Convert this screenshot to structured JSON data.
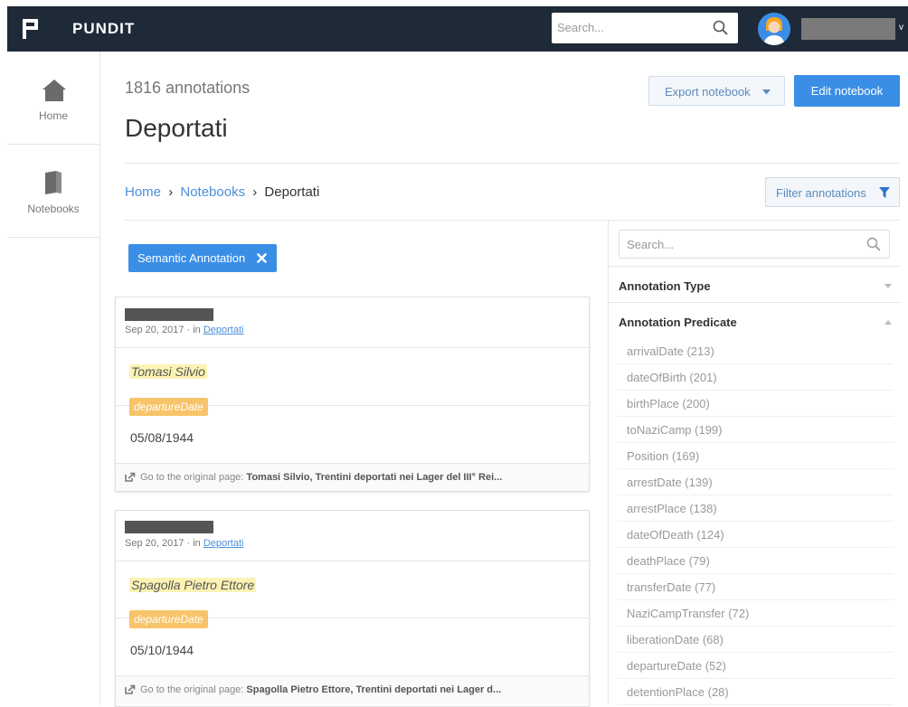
{
  "app": {
    "brand": "PUNDIT"
  },
  "header": {
    "search_placeholder": "Search...",
    "user_menu_caret": "v"
  },
  "nav": [
    {
      "label": "Home",
      "icon": "home-icon"
    },
    {
      "label": "Notebooks",
      "icon": "notebook-icon"
    }
  ],
  "main": {
    "count": "1816 annotations",
    "title": "Deportati",
    "export_label": "Export notebook",
    "edit_label": "Edit notebook",
    "breadcrumb": {
      "home": "Home",
      "sep1": "›",
      "notebooks": "Notebooks",
      "sep2": "›",
      "current": "Deportati"
    },
    "filter_label": "Filter annotations",
    "active_filter": "Semantic Annotation"
  },
  "cards": [
    {
      "date": "Sep 20, 2017 · in ",
      "notebook": "Deportati",
      "subject": "Tomasi Silvio",
      "predicate": "departureDate",
      "value": "05/08/1944",
      "footer_prefix": "Go to the original page: ",
      "footer_link": "Tomasi Silvio, Trentini deportati nei Lager del III° Rei..."
    },
    {
      "date": "Sep 20, 2017 · in ",
      "notebook": "Deportati",
      "subject": "Spagolla Pietro Ettore",
      "predicate": "departureDate",
      "value": "05/10/1944",
      "footer_prefix": "Go to the original page: ",
      "footer_link": "Spagolla Pietro Ettore, Trentini deportati nei Lager d..."
    }
  ],
  "sidebar": {
    "search_placeholder": "Search...",
    "annotation_type_label": "Annotation Type",
    "annotation_predicate_label": "Annotation Predicate",
    "predicates": [
      "arrivalDate (213)",
      "dateOfBirth (201)",
      "birthPlace (200)",
      "toNaziCamp (199)",
      "Position (169)",
      "arrestDate (139)",
      "arrestPlace (138)",
      "dateOfDeath (124)",
      "deathPlace (79)",
      "transferDate (77)",
      "NaziCampTransfer (72)",
      "liberationDate (68)",
      "departureDate (52)",
      "detentionPlace (28)"
    ]
  },
  "colors": {
    "topbar": "#1f2a38",
    "primary": "#3a8ee6",
    "highlight": "#fbf3b4",
    "predicate_tag": "#f8c46a",
    "link": "#4a90d9"
  }
}
